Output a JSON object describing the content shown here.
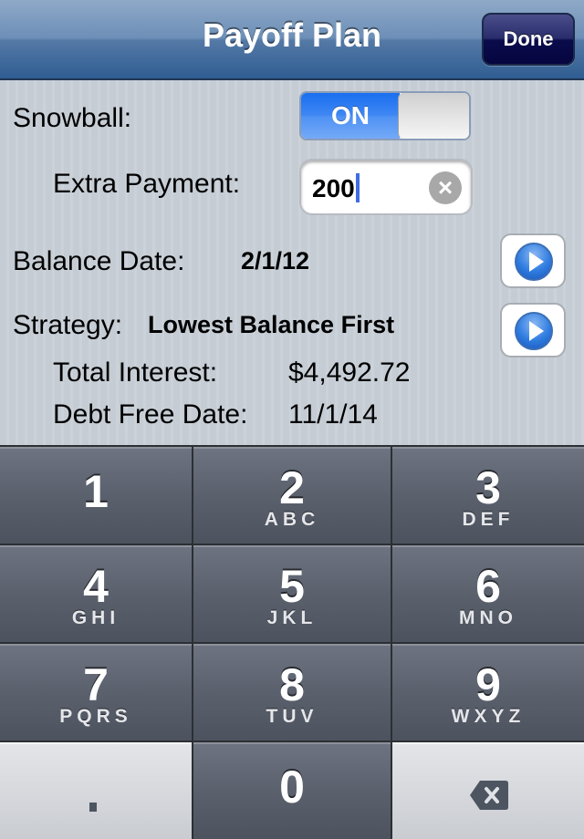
{
  "navbar": {
    "title": "Payoff Plan",
    "done_label": "Done"
  },
  "form": {
    "snowball_label": "Snowball:",
    "snowball_toggle": {
      "state": "ON",
      "on": true
    },
    "extra_payment_label": "Extra Payment:",
    "extra_payment_value": "200",
    "balance_date_label": "Balance Date:",
    "balance_date_value": "2/1/12",
    "strategy_label": "Strategy:",
    "strategy_value": "Lowest Balance First",
    "total_interest_label": "Total Interest:",
    "total_interest_value": "$4,492.72",
    "debt_free_label": "Debt Free Date:",
    "debt_free_value": "11/1/14"
  },
  "icons": {
    "clear": "clear-icon",
    "disclosure": "disclosure-arrow-icon",
    "backspace": "backspace-icon"
  },
  "keypad": {
    "keys": [
      {
        "num": "1",
        "letters": ""
      },
      {
        "num": "2",
        "letters": "ABC"
      },
      {
        "num": "3",
        "letters": "DEF"
      },
      {
        "num": "4",
        "letters": "GHI"
      },
      {
        "num": "5",
        "letters": "JKL"
      },
      {
        "num": "6",
        "letters": "MNO"
      },
      {
        "num": "7",
        "letters": "PQRS"
      },
      {
        "num": "8",
        "letters": "TUV"
      },
      {
        "num": "9",
        "letters": "WXYZ"
      },
      {
        "num": "0",
        "letters": ""
      }
    ],
    "decimal_label": ".",
    "clear_glyph": "×"
  },
  "colors": {
    "navbar": "#2f5d92",
    "done_button": "#0a0b4b",
    "toggle_on": "#3e86f3",
    "caret": "#3f6ee0",
    "keypad_key": "#5a606c"
  }
}
